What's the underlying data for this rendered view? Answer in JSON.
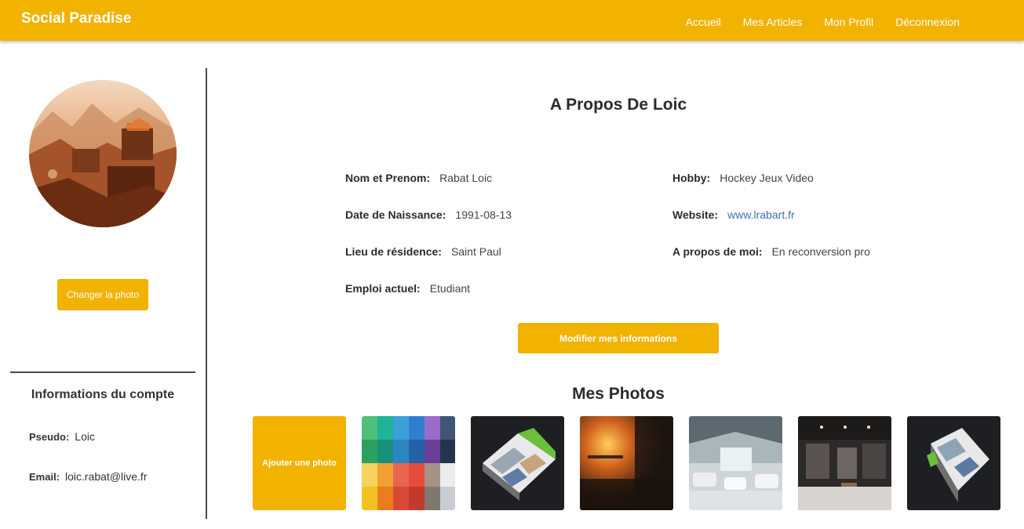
{
  "brand": "Social Paradise",
  "nav": {
    "items": [
      "Accueil",
      "Mes Articles",
      "Mon Profil",
      "Déconnexion"
    ]
  },
  "sidebar": {
    "change_photo_label": "Changer la photo",
    "account_title": "Informations du compte",
    "pseudo_label": "Pseudo:",
    "pseudo_value": "Loic",
    "email_label": "Email:",
    "email_value": "loic.rabat@live.fr"
  },
  "about": {
    "title": "A Propos De Loic",
    "fields": [
      {
        "label": "Nom et Prenom:",
        "value": "Rabat Loic"
      },
      {
        "label": "Date de Naissance:",
        "value": "1991-08-13"
      },
      {
        "label": "Lieu de résidence:",
        "value": "Saint Paul"
      },
      {
        "label": "Emploi actuel:",
        "value": "Etudiant"
      },
      {
        "label": "Hobby:",
        "value": "Hockey Jeux Video"
      },
      {
        "label": "Website:",
        "value": "www.lrabart.fr"
      },
      {
        "label": "A propos de moi:",
        "value": "En reconversion pro"
      }
    ],
    "modify_label": "Modifier mes informations"
  },
  "photos": {
    "title": "Mes Photos",
    "add_label": "Ajouter une photo"
  },
  "colors": {
    "accent": "#f2b200",
    "link": "#3b6fb5"
  }
}
